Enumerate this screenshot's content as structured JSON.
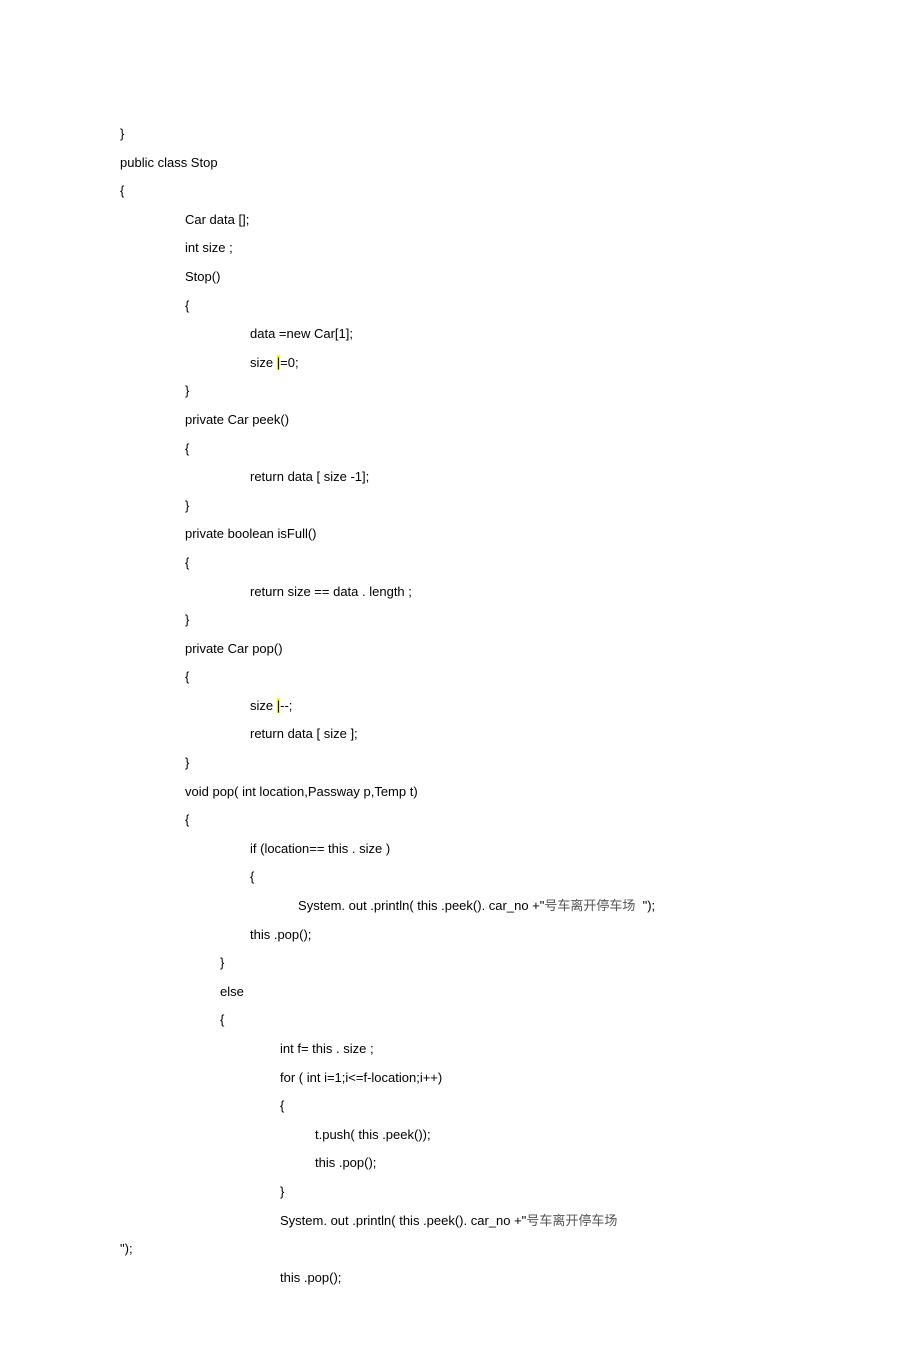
{
  "code": {
    "lines": [
      {
        "indent": 0,
        "text": "}"
      },
      {
        "indent": 0,
        "text": "public class Stop"
      },
      {
        "indent": 0,
        "text": "{"
      },
      {
        "indent": 1,
        "text": "Car data [];"
      },
      {
        "indent": 1,
        "text": "int size ;"
      },
      {
        "indent": 1,
        "text": "Stop()"
      },
      {
        "indent": 1,
        "text": "{"
      },
      {
        "indent": 2,
        "text": "data =new Car[1];"
      },
      {
        "indent": 2,
        "parts": [
          {
            "t": "size "
          },
          {
            "t": "|",
            "hl": true
          },
          {
            "t": "=0;"
          }
        ]
      },
      {
        "indent": 1,
        "text": "}"
      },
      {
        "indent": 1,
        "text": "private Car peek()"
      },
      {
        "indent": 1,
        "text": "{"
      },
      {
        "indent": 2,
        "text": "return data [ size -1];"
      },
      {
        "indent": 1,
        "text": "}"
      },
      {
        "indent": 1,
        "text": "private boolean isFull()"
      },
      {
        "indent": 1,
        "text": "{"
      },
      {
        "indent": 2,
        "text": "return size == data . length ;"
      },
      {
        "indent": 1,
        "text": "}"
      },
      {
        "indent": 1,
        "text": "private Car pop()"
      },
      {
        "indent": 1,
        "text": "{"
      },
      {
        "indent": 2,
        "parts": [
          {
            "t": "size "
          },
          {
            "t": "|",
            "hl": true
          },
          {
            "t": "--;"
          }
        ]
      },
      {
        "indent": 2,
        "text": "return data [ size ];"
      },
      {
        "indent": 1,
        "text": "}"
      },
      {
        "indent": 1,
        "text": "void pop( int location,Passway p,Temp t)"
      },
      {
        "indent": 1,
        "text": "{"
      },
      {
        "indent": 2,
        "text": "if (location== this . size )"
      },
      {
        "indent": 2,
        "text": "{"
      },
      {
        "indent": 3,
        "parts": [
          {
            "t": "     System. out .println( this .peek(). car_no +\""
          },
          {
            "t": "号车离开停车场  ",
            "cjk": true
          },
          {
            "t": "\");"
          }
        ]
      },
      {
        "indent": 2,
        "text": "this .pop();"
      },
      {
        "indent": 2,
        "text": "}",
        "lpad": -30
      },
      {
        "indent": 2,
        "text": "else",
        "lpad": -30
      },
      {
        "indent": 2,
        "text": "{",
        "lpad": -30
      },
      {
        "indent": 3,
        "text": "int f= this . size ;"
      },
      {
        "indent": 3,
        "text": "for ( int i=1;i<=f-location;i++)"
      },
      {
        "indent": 3,
        "text": "{"
      },
      {
        "indent": 4,
        "text": "t.push( this .peek());"
      },
      {
        "indent": 4,
        "text": "this .pop();"
      },
      {
        "indent": 3,
        "text": "}"
      },
      {
        "indent": 3,
        "parts": [
          {
            "t": "System. out .println( this .peek(). car_no +\""
          },
          {
            "t": "号车离开停车场",
            "cjk": true
          }
        ]
      },
      {
        "indent": 0,
        "text": "\");"
      },
      {
        "indent": 3,
        "text": "this .pop();"
      }
    ]
  }
}
